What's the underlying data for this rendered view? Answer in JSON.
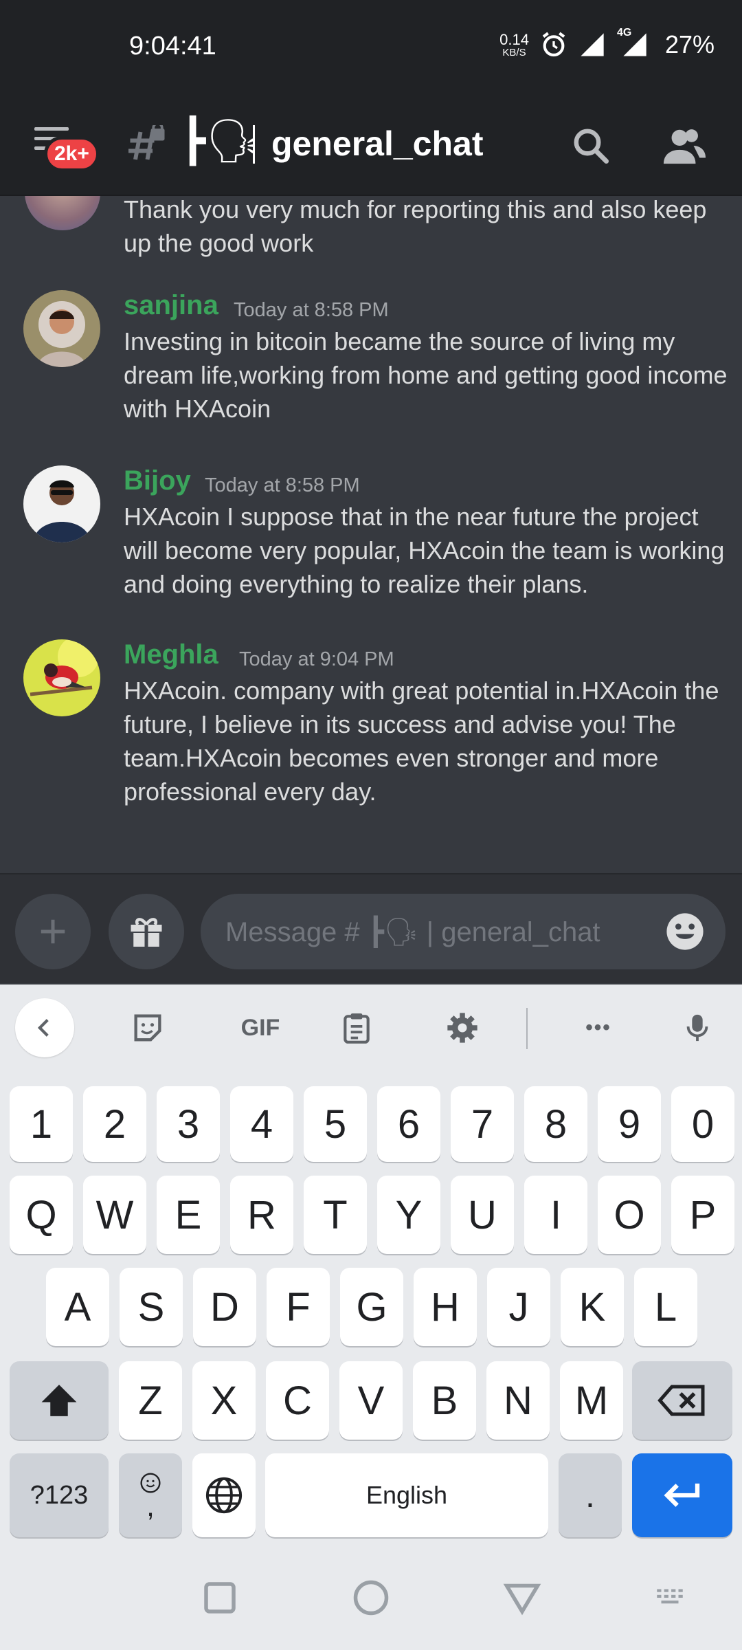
{
  "status_bar": {
    "time": "9:04:41",
    "net_speed_value": "0.14",
    "net_speed_unit": "KB/S",
    "network": "4G",
    "battery": "27%"
  },
  "header": {
    "unread_badge": "2k+",
    "channel_emoji": "┣🗣",
    "channel_name": "general_chat"
  },
  "messages": {
    "partial_text": "Thank you very much for reporting this and also keep up the good work",
    "items": [
      {
        "author": "sanjina",
        "timestamp": "Today at 8:58 PM",
        "text": "Investing in bitcoin became the source of living my dream life,working from home and getting good income with HXAcoin"
      },
      {
        "author": "Bijoy",
        "timestamp": "Today at 8:58 PM",
        "text": "HXAcoin  I suppose that in the near future the project will become very popular, HXAcoin  the team is working and doing everything to realize their plans."
      },
      {
        "author": "Meghla",
        "timestamp": "Today at 9:04 PM",
        "text": "HXAcoin. company with great potential in.HXAcoin the future, I believe in its success and advise you! The team.HXAcoin becomes even stronger and more professional every day."
      }
    ]
  },
  "composer": {
    "placeholder": "Message # ┣🗣 | general_chat"
  },
  "keyboard": {
    "toolbar_gif": "GIF",
    "toolbar_more": "•••",
    "row_numbers": [
      "1",
      "2",
      "3",
      "4",
      "5",
      "6",
      "7",
      "8",
      "9",
      "0"
    ],
    "row1": [
      "Q",
      "W",
      "E",
      "R",
      "T",
      "Y",
      "U",
      "I",
      "O",
      "P"
    ],
    "row2": [
      "A",
      "S",
      "D",
      "F",
      "G",
      "H",
      "J",
      "K",
      "L"
    ],
    "row3": [
      "Z",
      "X",
      "C",
      "V",
      "B",
      "N",
      "M"
    ],
    "symbols_label": "?123",
    "comma_label": ",",
    "space_label": "English",
    "period_label": "."
  },
  "colors": {
    "background": "#36393f",
    "header": "#202225",
    "username": "#3ba55c",
    "badge": "#ed4245",
    "enter_key": "#1a73e8"
  }
}
